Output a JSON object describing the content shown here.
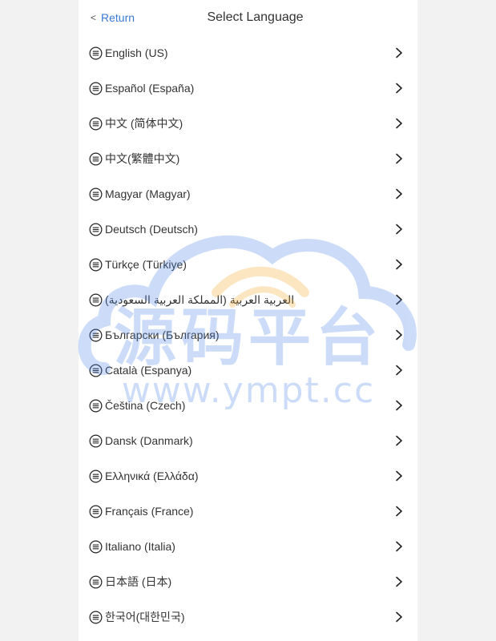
{
  "header": {
    "back_icon": "chevron-left-icon",
    "back_label": "Return",
    "title": "Select Language"
  },
  "languages": [
    {
      "label": "English (US)"
    },
    {
      "label": "Español (España)"
    },
    {
      "label": "中文 (简体中文)"
    },
    {
      "label": "中文(繁體中文)"
    },
    {
      "label": "Magyar (Magyar)"
    },
    {
      "label": "Deutsch (Deutsch)"
    },
    {
      "label": "Türkçe (Türkiye)"
    },
    {
      "label": "العربية العربية (المملكة العربية السعودية)"
    },
    {
      "label": "Български (България)"
    },
    {
      "label": "Català (Espanya)"
    },
    {
      "label": "Čeština (Czech)"
    },
    {
      "label": "Dansk (Danmark)"
    },
    {
      "label": "Ελληνικά (Ελλάδα)"
    },
    {
      "label": "Français (France)"
    },
    {
      "label": "Italiano (Italia)"
    },
    {
      "label": "日本語 (日本)"
    },
    {
      "label": "한국어(대한민국)"
    }
  ],
  "icons": {
    "item_icon": "list-icon",
    "item_arrow": "chevron-right-icon"
  },
  "watermark": {
    "title": "源码平台",
    "url": "www.ympt.cc",
    "color": "#4a86e8",
    "accent": "#f5a623"
  },
  "colors": {
    "link": "#3a7bd5",
    "text": "#333333",
    "background": "#f2f2f2",
    "panel": "#ffffff"
  }
}
